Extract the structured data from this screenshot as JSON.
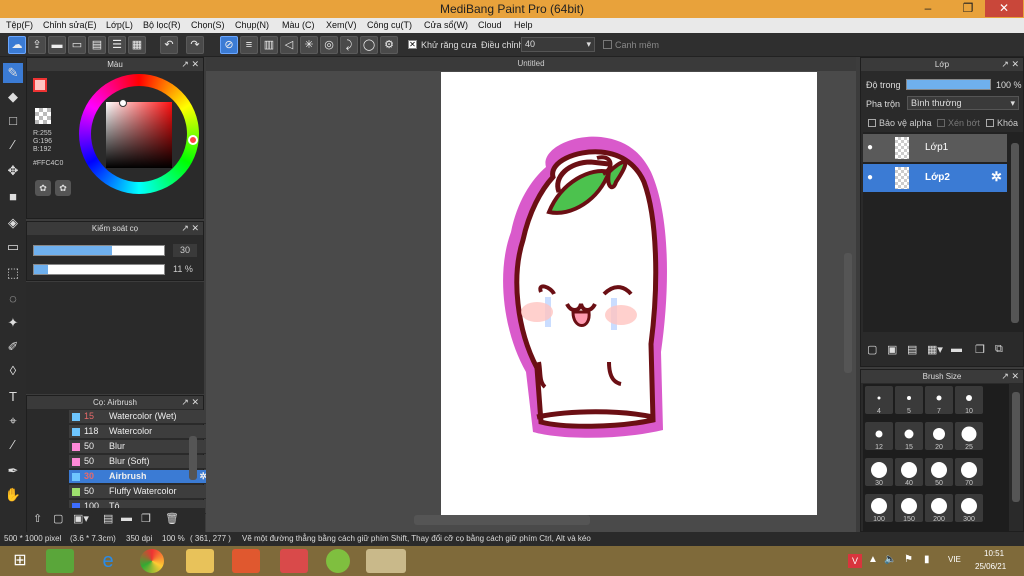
{
  "window": {
    "title": "MediBang Paint Pro (64bit)",
    "min": "–",
    "max": "❐",
    "close": "✕"
  },
  "menu": [
    "Tệp(F)",
    "Chỉnh sửa(E)",
    "Lớp(L)",
    "Bộ lọc(R)",
    "Chọn(S)",
    "Chụp(N)",
    "Màu (C)",
    "Xem(V)",
    "Công cụ(T)",
    "Cửa sổ(W)",
    "Cloud",
    "Help"
  ],
  "toolbar": {
    "antialias_label": "Khử răng cưa",
    "adjust_label": "Điều chỉnh",
    "adjust_value": "40",
    "snap_label": "Canh mêm"
  },
  "color_panel": {
    "title": "Màu",
    "r": "R:255",
    "g": "G:196",
    "b": "B:192",
    "hex": "#FFC4C0"
  },
  "brush_control": {
    "title": "Kiểm soát cọ",
    "size_value": "30",
    "opacity_value": "11 %",
    "size_fill": 0.6,
    "opacity_fill": 0.11
  },
  "brush_list": {
    "title": "Cọ: Airbrush",
    "items": [
      {
        "size": "15",
        "name": "Watercolor (Wet)",
        "color": "#6ec6ff"
      },
      {
        "size": "118",
        "name": "Watercolor",
        "color": "#6ec6ff"
      },
      {
        "size": "50",
        "name": "Blur",
        "color": "#ff8ad8"
      },
      {
        "size": "50",
        "name": "Blur (Soft)",
        "color": "#ff8ad8"
      },
      {
        "size": "30",
        "name": "Airbrush",
        "color": "#6ec6ff"
      },
      {
        "size": "50",
        "name": "Fluffy Watercolor",
        "color": "#9ee06e"
      },
      {
        "size": "100",
        "name": "Tô",
        "color": "#3d6dff"
      }
    ]
  },
  "document": {
    "tab": "Untitled"
  },
  "layer_panel": {
    "title": "Lớp",
    "opacity_label": "Độ trong",
    "opacity_value": "100 %",
    "blend_label": "Pha trộn",
    "blend_value": "Bình thường",
    "protect_alpha": "Bảo vệ alpha",
    "clipping": "Xén bớt",
    "lock": "Khóa",
    "layers": [
      "Lớp1",
      "Lớp2"
    ]
  },
  "brush_size": {
    "title": "Brush Size",
    "sizes": [
      "4",
      "5",
      "7",
      "10",
      "12",
      "15",
      "20",
      "25",
      "30",
      "40",
      "50",
      "70",
      "100",
      "150",
      "200",
      "300"
    ]
  },
  "status": {
    "dimensions": "500 * 1000 pixel",
    "physical": "(3.6 * 7.3cm)",
    "dpi": "350 dpi",
    "zoom": "100 %",
    "coords": "( 361, 277 )",
    "hint": "Vẽ một đường thẳng bằng cách giữ phím Shift, Thay đổi cỡ cọ bằng cách giữ phím Ctrl, Alt và kéo"
  },
  "taskbar": {
    "lang": "VIE",
    "time": "10:51",
    "date": "25/06/21"
  }
}
